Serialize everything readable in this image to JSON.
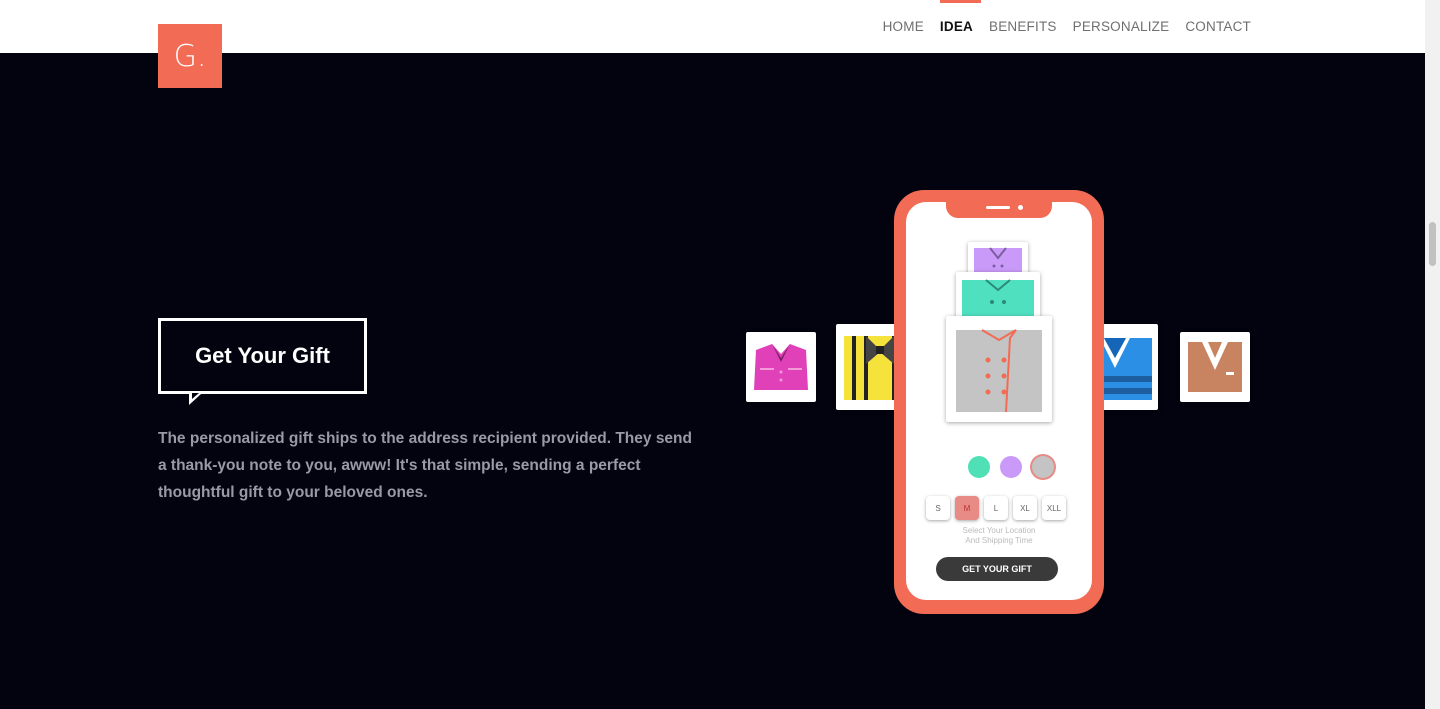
{
  "logo": {
    "text": "G."
  },
  "nav": {
    "items": [
      {
        "label": "HOME"
      },
      {
        "label": "IDEA",
        "active": true
      },
      {
        "label": "BENEFITS"
      },
      {
        "label": "PERSONALIZE"
      },
      {
        "label": "CONTACT"
      }
    ]
  },
  "hero": {
    "bubble_title": "Get Your Gift",
    "description": "The personalized gift ships to the address recipient provided. They send a thank-you note to you, awww! It's that simple, sending a perfect thoughtful gift to your beloved ones."
  },
  "phone": {
    "sizes": [
      "S",
      "M",
      "L",
      "XL",
      "XLL"
    ],
    "selected_size": "M",
    "location_line1": "Select Your Location",
    "location_line2": "And Shipping Time",
    "cta": "GET YOUR GIFT",
    "color_options": [
      "#4fe0b6",
      "#c99af8",
      "#c4c4c4"
    ]
  },
  "colors": {
    "accent": "#f26b55",
    "background": "#02030f",
    "header": "#ffffff"
  },
  "icons": [
    "pink-shirt-icon",
    "yellow-striped-shirt-icon",
    "purple-chef-jacket-icon",
    "teal-chef-jacket-icon",
    "gray-chef-jacket-icon",
    "blue-sweater-icon",
    "brown-blazer-icon"
  ]
}
